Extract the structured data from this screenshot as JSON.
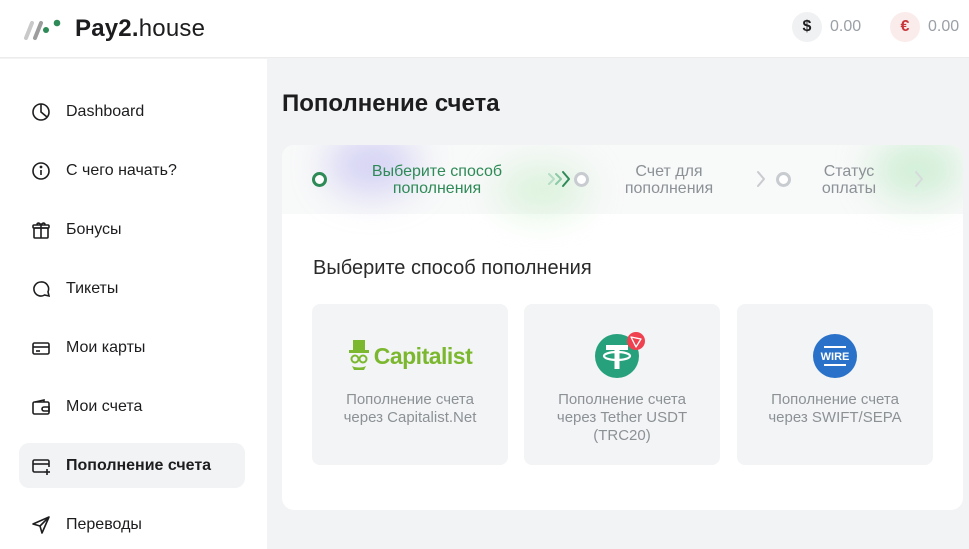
{
  "app": {
    "logo_brand": "Pay2",
    "logo_dot": ".",
    "logo_suffix": "house"
  },
  "header": {
    "balances": [
      {
        "symbol": "$",
        "value": "0.00",
        "color": "#1d1d1f",
        "bg": "#f0f1f2",
        "icon": "dollar-icon"
      },
      {
        "symbol": "€",
        "value": "0.00",
        "color": "#c8363a",
        "bg": "#fbecec",
        "icon": "euro-icon"
      }
    ]
  },
  "sidebar": {
    "items": [
      {
        "label": "Dashboard",
        "icon": "pie-chart-icon",
        "active": false
      },
      {
        "label": "С чего начать?",
        "icon": "info-icon",
        "active": false
      },
      {
        "label": "Бонусы",
        "icon": "gift-icon",
        "active": false
      },
      {
        "label": "Тикеты",
        "icon": "chat-bubble-icon",
        "active": false
      },
      {
        "label": "Мои карты",
        "icon": "cards-icon",
        "active": false
      },
      {
        "label": "Мои счета",
        "icon": "wallet-icon",
        "active": false
      },
      {
        "label": "Пополнение счета",
        "icon": "card-add-icon",
        "active": true
      },
      {
        "label": "Переводы",
        "icon": "send-icon",
        "active": false
      }
    ]
  },
  "main": {
    "title": "Пополнение счета",
    "steps": [
      {
        "line1": "Выберите способ",
        "line2": "пополнения",
        "active": true
      },
      {
        "line1": "Счет для",
        "line2": "пополнения",
        "active": false
      },
      {
        "line1": "Статус",
        "line2": "оплаты",
        "active": false
      }
    ],
    "section_title": "Выберите способ пополнения",
    "methods": [
      {
        "logo_text": "Capitalist",
        "line1": "Пополнение счета",
        "line2": "через Capitalist.Net",
        "line3": "",
        "icon": "capitalist-logo"
      },
      {
        "logo_text": "",
        "line1": "Пополнение счета",
        "line2": "через Tether USDT",
        "line3": "(TRC20)",
        "icon": "tether-icon"
      },
      {
        "logo_text": "WIRE",
        "line1": "Пополнение счета",
        "line2": "через SWIFT/SEPA",
        "line3": "",
        "icon": "wire-icon"
      }
    ],
    "accent_color": "#2e8a57"
  }
}
